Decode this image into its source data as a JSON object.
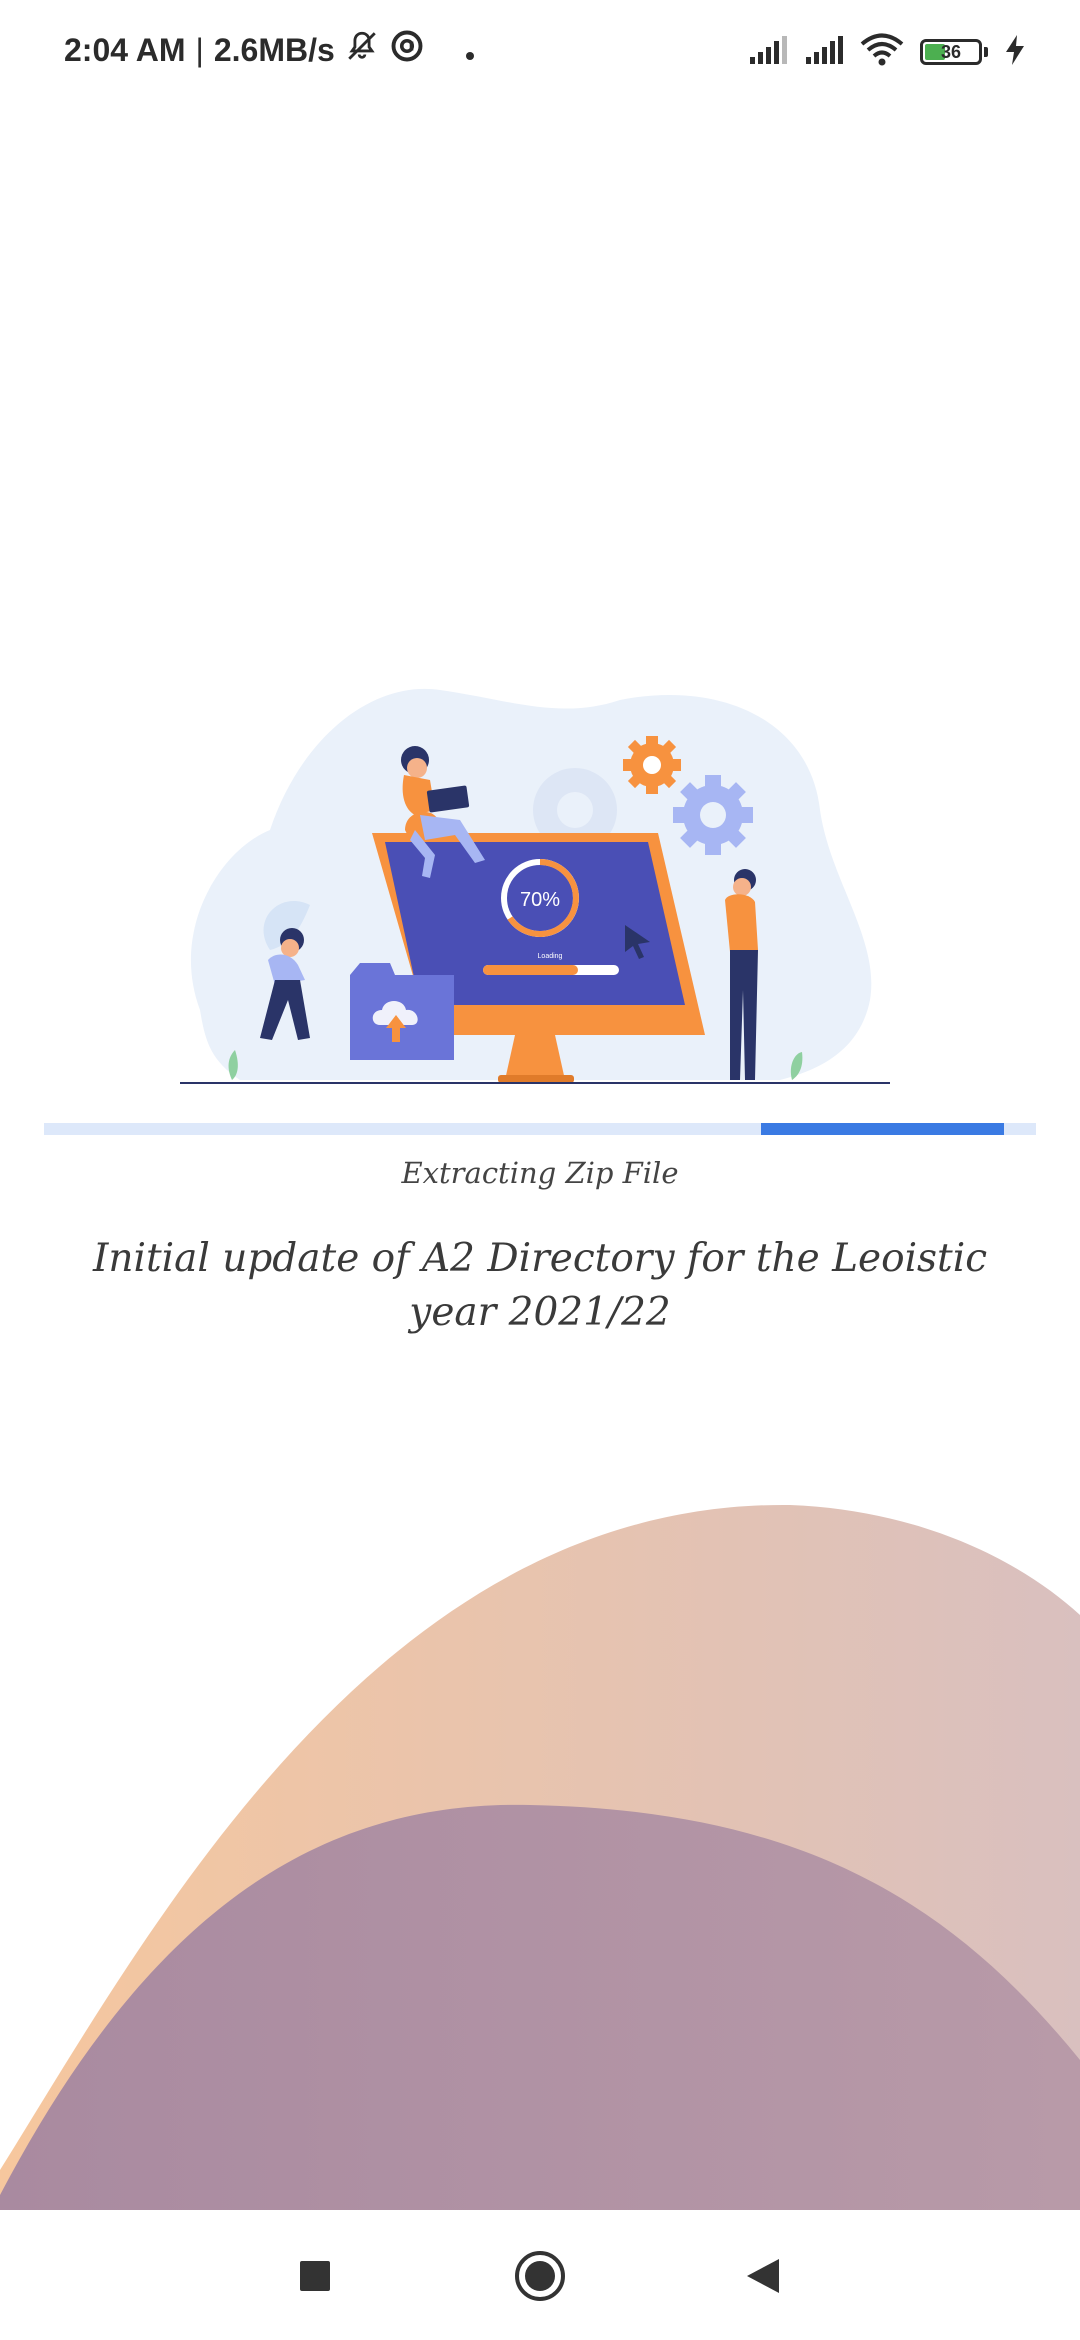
{
  "status_bar": {
    "time": "2:04 AM",
    "separator": "|",
    "speed": "2.6MB/s",
    "battery_level": "36",
    "icons": [
      "bell-off-icon",
      "at-circle-icon",
      "dot-icon",
      "signal-icon",
      "signal-icon",
      "wifi-icon",
      "battery-icon",
      "charging-bolt-icon"
    ]
  },
  "illustration": {
    "progress_label": "70%",
    "loading_label": "Loading"
  },
  "progress": {
    "start_fraction": 0.723,
    "end_fraction": 0.968,
    "status": "Extracting Zip File"
  },
  "message": {
    "title": "Initial update of A2 Directory for the Leoistic year 2021/22"
  },
  "colors": {
    "accent": "#3a7ae3",
    "track": "#dde8fa",
    "orange": "#f7923f",
    "indigo": "#4a4fb5",
    "wave_light": "#f2c7a6",
    "wave_dark": "#a8899f"
  },
  "nav_bar": {
    "icons": [
      "recent-apps-icon",
      "home-icon",
      "back-icon"
    ]
  }
}
